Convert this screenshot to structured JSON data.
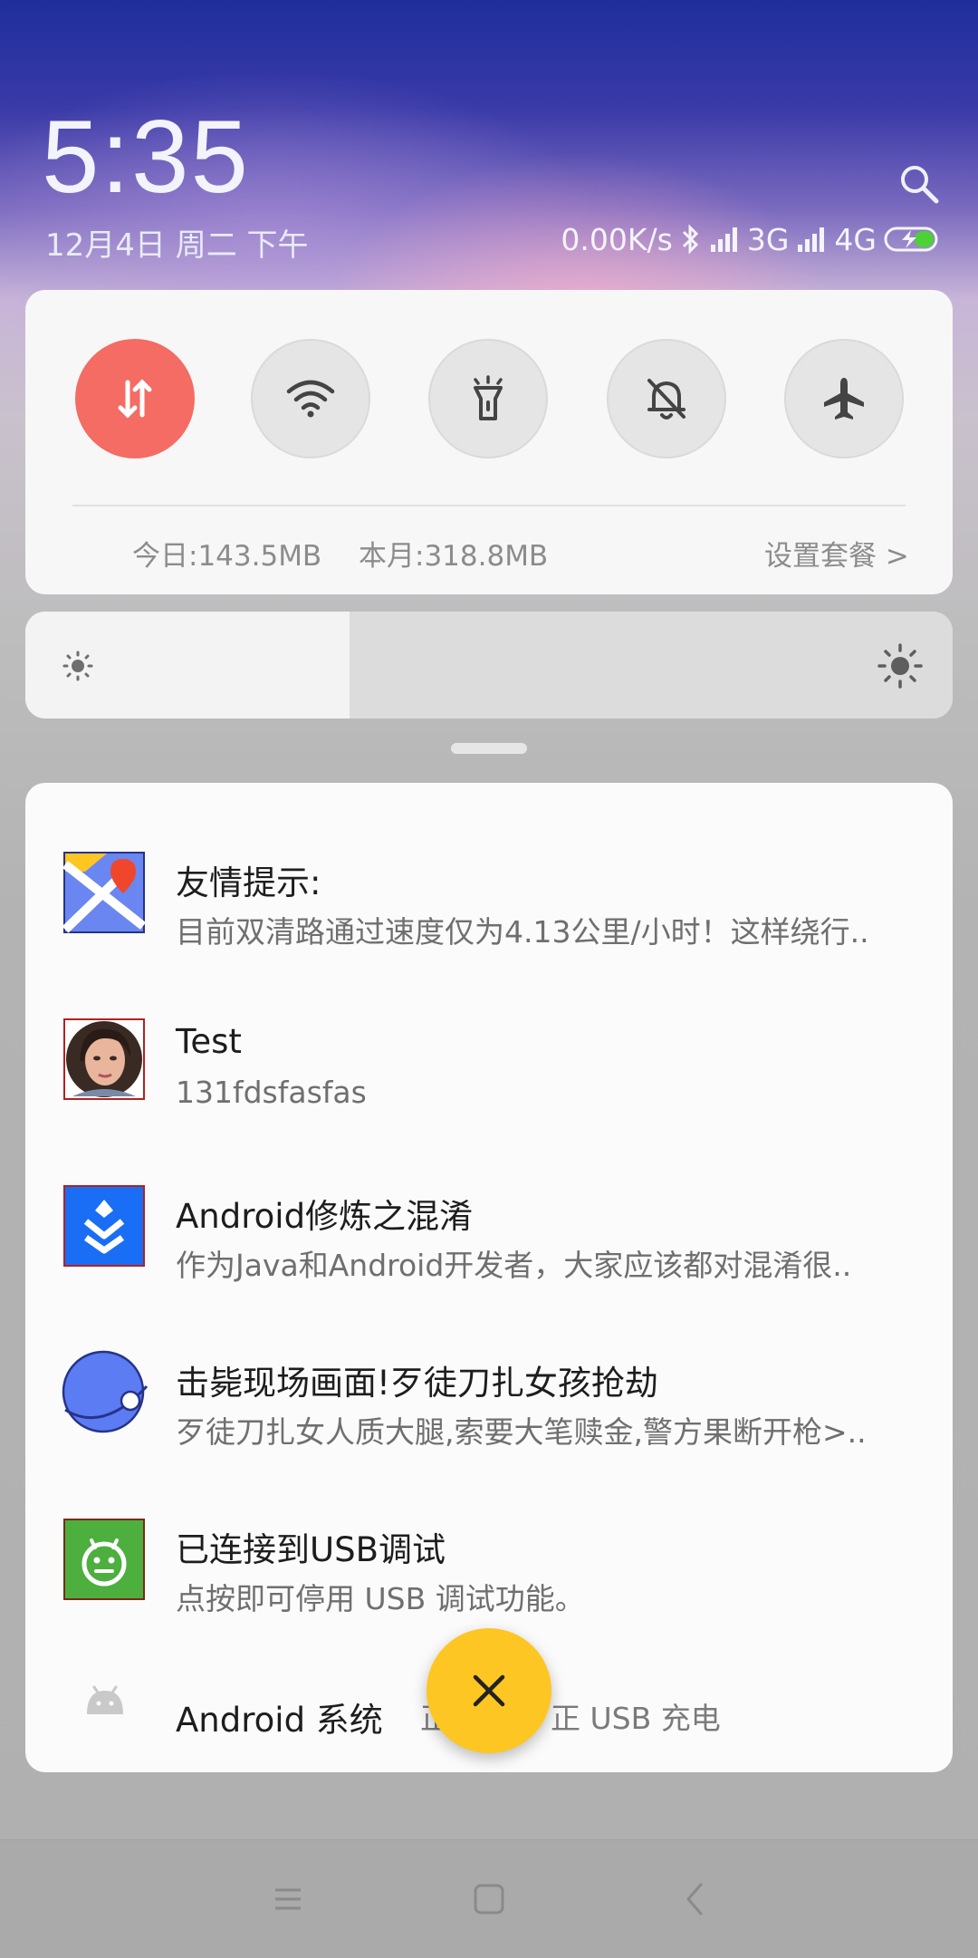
{
  "status_bar": {
    "time": "5:35",
    "date": "12月4日 周二 下午",
    "net_speed": "0.00K/s",
    "sim1": "3G",
    "sim2": "4G"
  },
  "quick_settings": {
    "toggles": [
      {
        "name": "mobile-data",
        "active": true
      },
      {
        "name": "wifi",
        "active": false
      },
      {
        "name": "flashlight",
        "active": false
      },
      {
        "name": "silent",
        "active": false
      },
      {
        "name": "airplane",
        "active": false
      }
    ],
    "today_usage": "今日:143.5MB",
    "month_usage": "本月:318.8MB",
    "plan_link": "设置套餐 >"
  },
  "brightness": {
    "level": 0.35
  },
  "notifications": [
    {
      "icon": "map-app-icon",
      "title": "友情提示:",
      "text": "目前双清路通过速度仅为4.13公里/小时！这样绕行.."
    },
    {
      "icon": "avatar",
      "title": "Test",
      "text": "131fdsfasfas"
    },
    {
      "icon": "blue-app-icon",
      "title": " Android修炼之混淆",
      "text": "作为Java和Android开发者，大家应该都对混淆很.."
    },
    {
      "icon": "browser-planet-icon",
      "title": "击毙现场画面!歹徒刀扎女孩抢劫",
      "text": "歹徒刀扎女人质大腿,索要大笔赎金,警方果断开枪>.."
    },
    {
      "icon": "android-green-icon",
      "title": "已连接到USB调试",
      "text": "点按即可停用 USB 调试功能。"
    }
  ],
  "system_row": {
    "app": "Android 系统",
    "text_left": "正",
    "text_right": "正 USB 充电"
  },
  "colors": {
    "accent_red": "#f46c63",
    "fab_yellow": "#fdc623"
  }
}
